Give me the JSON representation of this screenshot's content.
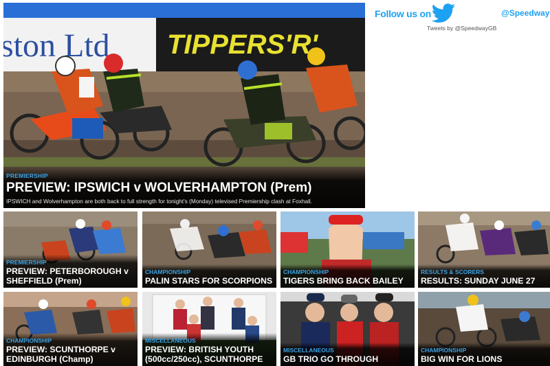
{
  "hero": {
    "category": "PREMIERSHIP",
    "title": "PREVIEW: IPSWICH v WOLVERHAMPTON (Prem)",
    "excerpt": "IPSWICH and Wolverhampton are both back to full strength for tonight's (Monday) televised Premiership clash at Foxhall.",
    "banner_left": "ston Ltd",
    "banner_right": "TIPPERS'R'"
  },
  "twitter": {
    "follow_label": "Follow us on",
    "handle": "@SpeedwayGB",
    "tweets_by": "Tweets by @SpeedwayGB",
    "icon": "twitter-bird-icon",
    "color": "#1da1f2"
  },
  "cards": [
    {
      "category": "PREMIERSHIP",
      "title": "PREVIEW: PETERBOROUGH v SHEFFIELD (Prem)"
    },
    {
      "category": "CHAMPIONSHIP",
      "title": "PALIN STARS FOR SCORPIONS"
    },
    {
      "category": "CHAMPIONSHIP",
      "title": "TIGERS BRING BACK BAILEY"
    },
    {
      "category": "RESULTS & SCORERS",
      "title": "RESULTS: SUNDAY JUNE 27"
    },
    {
      "category": "CHAMPIONSHIP",
      "title": "PREVIEW: SCUNTHORPE v EDINBURGH (Champ)"
    },
    {
      "category": "MISCELLANEOUS",
      "title": "PREVIEW: BRITISH YOUTH (500cc/250cc), SCUNTHORPE"
    },
    {
      "category": "MISCELLANEOUS",
      "title": "GB TRIO GO THROUGH"
    },
    {
      "category": "CHAMPIONSHIP",
      "title": "BIG WIN FOR LIONS"
    }
  ],
  "colors": {
    "category_blue": "#3ba3e6",
    "twitter_blue": "#1da1f2"
  }
}
